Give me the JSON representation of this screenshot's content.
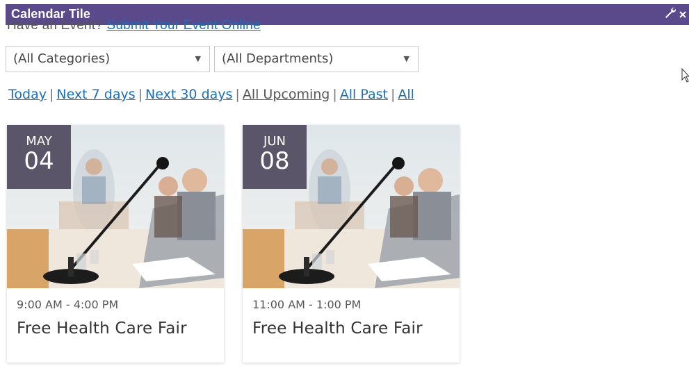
{
  "titlebar": {
    "title": "Calendar Tile",
    "wrench_icon": "wrench-icon",
    "close_icon": "close-icon",
    "color": "#5b4a8b"
  },
  "submit": {
    "prompt": "Have an Event?",
    "link": "Submit Your Event Online"
  },
  "filters": {
    "category_value": "(All Categories)",
    "department_value": "(All Departments)",
    "links": [
      "Today",
      "Next 7 days",
      "Next 30 days",
      "All Upcoming",
      "All Past",
      "All"
    ]
  },
  "events": [
    {
      "month": "MAY",
      "day": "04",
      "time": "9:00 AM - 4:00 PM",
      "name": "Free Health Care Fair"
    },
    {
      "month": "JUN",
      "day": "08",
      "time": "11:00 AM - 1:00 PM",
      "name": "Free Health Care Fair"
    }
  ],
  "colors": {
    "link": "#1a6fb5",
    "date_badge": "#5a5568"
  }
}
